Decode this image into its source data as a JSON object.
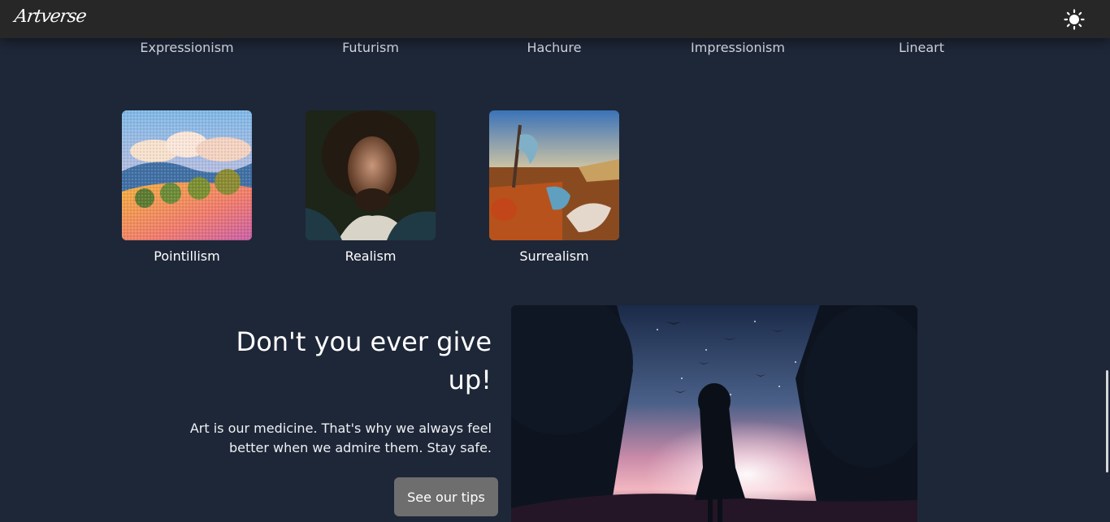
{
  "navbar": {
    "logo": "Artverse",
    "theme_icon": "sun-icon"
  },
  "categories_row1": [
    {
      "label": "Expressionism"
    },
    {
      "label": "Futurism"
    },
    {
      "label": "Hachure"
    },
    {
      "label": "Impressionism"
    },
    {
      "label": "Lineart"
    }
  ],
  "categories_row2": [
    {
      "label": "Pointillism",
      "image": "pointillism-landscape"
    },
    {
      "label": "Realism",
      "image": "realism-portrait"
    },
    {
      "label": "Surrealism",
      "image": "surrealism-melting-clocks"
    }
  ],
  "promo": {
    "title": "Don't you ever give up!",
    "text": "Art is our medicine. That's why we always feel better when we admire them. Stay safe.",
    "button": "See our tips",
    "image": "anime-girl-sunset"
  },
  "colors": {
    "background": "#1e2738",
    "navbar": "#272727",
    "button": "#6e6e6e"
  }
}
